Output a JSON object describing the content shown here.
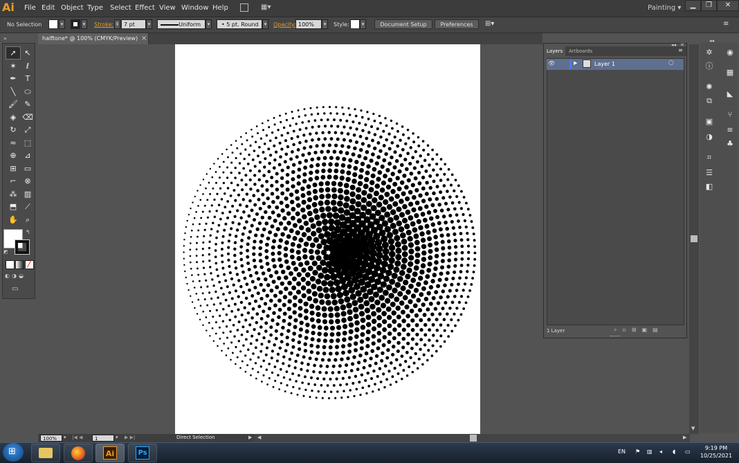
{
  "app": {
    "logo": "Ai"
  },
  "menu": [
    "File",
    "Edit",
    "Object",
    "Type",
    "Select",
    "Effect",
    "View",
    "Window",
    "Help"
  ],
  "workspace": "Painting",
  "window_buttons": {
    "minimize": "▁",
    "restore": "❐",
    "close": "✕"
  },
  "control": {
    "selection_label": "No Selection",
    "stroke_label": "Stroke:",
    "stroke_value": "7 pt",
    "profile": "Uniform",
    "brush": "5 pt. Round",
    "opacity_label": "Opacity:",
    "opacity_value": "100%",
    "style_label": "Style:",
    "document_setup": "Document Setup",
    "preferences": "Preferences"
  },
  "document_tab": {
    "title": "halftone* @ 100% (CMYK/Preview)",
    "close": "×"
  },
  "layers_panel": {
    "tabs": [
      "Layers",
      "Artboards"
    ],
    "layer_name": "Layer 1",
    "footer": "1 Layer"
  },
  "status": {
    "zoom": "100%",
    "artboard": "1",
    "tool": "Direct Selection"
  },
  "taskbar": {
    "lang": "EN",
    "time": "9:19 PM",
    "date": "10/25/2021",
    "apps": [
      "Explorer",
      "Firefox",
      "Illustrator",
      "Photoshop"
    ]
  },
  "colors": {
    "accent": "#e99b2a",
    "selection": "#5f6f8f"
  },
  "artwork": {
    "kind": "radial halftone dot sphere",
    "center_dot_max": 14
  }
}
